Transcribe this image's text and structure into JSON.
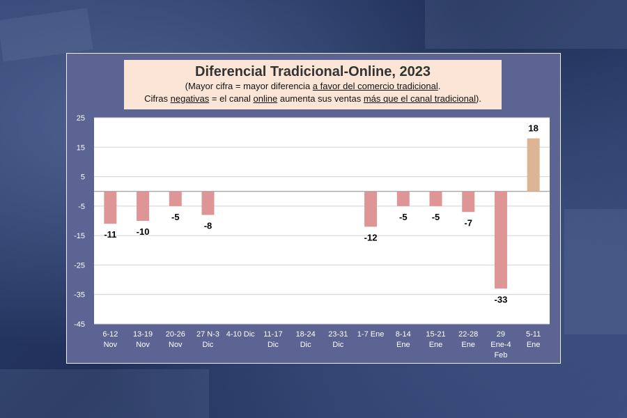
{
  "chart_data": {
    "type": "bar",
    "title": "Diferencial Tradicional-Online, 2023",
    "subtitle_line1": [
      {
        "text": "(Mayor cifra = mayor diferencia ",
        "u": false
      },
      {
        "text": "a favor del comercio tradicional",
        "u": true
      },
      {
        "text": ".",
        "u": false
      }
    ],
    "subtitle_line2": [
      {
        "text": "Cifras ",
        "u": false
      },
      {
        "text": "negativas",
        "u": true
      },
      {
        "text": " = el canal ",
        "u": false
      },
      {
        "text": "online",
        "u": true
      },
      {
        "text": " aumenta sus ventas ",
        "u": false
      },
      {
        "text": "más que el canal tradicional",
        "u": true
      },
      {
        "text": ").",
        "u": false
      }
    ],
    "categories": [
      [
        "6-12",
        "Nov"
      ],
      [
        "13-19",
        "Nov"
      ],
      [
        "20-26",
        "Nov"
      ],
      [
        "27 N-3",
        "Dic"
      ],
      [
        "4-10 Dic"
      ],
      [
        "11-17",
        "Dic"
      ],
      [
        "18-24",
        "Dic"
      ],
      [
        "23-31",
        "Dic"
      ],
      [
        "1-7 Ene"
      ],
      [
        "8-14",
        "Ene"
      ],
      [
        "15-21",
        "Ene"
      ],
      [
        "22-28",
        "Ene"
      ],
      [
        "29",
        "Ene-4",
        "Feb"
      ],
      [
        "5-11",
        "Ene"
      ]
    ],
    "values": [
      -11,
      -10,
      -5,
      -8,
      null,
      null,
      null,
      null,
      -12,
      -5,
      -5,
      -7,
      -33,
      18
    ],
    "ylim": [
      -45,
      25
    ],
    "yticks": [
      25,
      15,
      5,
      -5,
      -15,
      -25,
      -35,
      -45
    ],
    "colors": {
      "negative": "#de9595",
      "positive": "#dcb595",
      "plot_bg": "#ffffff",
      "grid": "#d0d0d8"
    },
    "grid": true,
    "legend": "none"
  }
}
